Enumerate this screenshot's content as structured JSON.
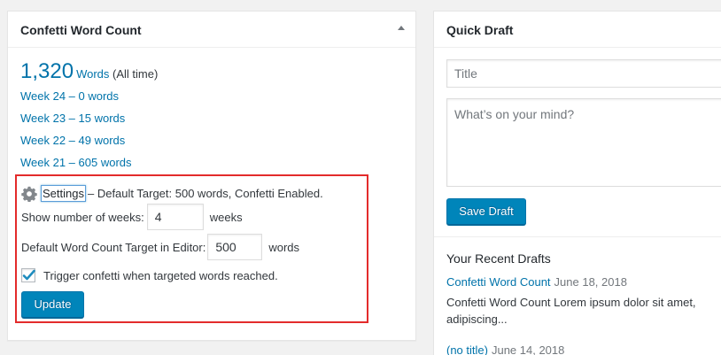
{
  "confetti_widget": {
    "title": "Confetti Word Count",
    "total_number": "1,320",
    "total_words_label": "Words",
    "total_suffix": "(All time)",
    "weeks": [
      "Week 24 – 0 words",
      "Week 23 – 15 words",
      "Week 22 – 49 words",
      "Week 21 – 605 words"
    ],
    "settings": {
      "link_label": "Settings",
      "summary": "– Default Target: 500 words, Confetti Enabled.",
      "weeks_label": "Show number of weeks:",
      "weeks_value": "4",
      "weeks_suffix": "weeks",
      "target_label": "Default Word Count Target in Editor:",
      "target_value": "500",
      "target_suffix": "words",
      "confetti_label": "Trigger confetti when targeted words reached.",
      "confetti_checked": true,
      "update_label": "Update"
    }
  },
  "quick_draft": {
    "title": "Quick Draft",
    "title_placeholder": "Title",
    "content_placeholder": "What’s on your mind?",
    "save_label": "Save Draft",
    "recent_title": "Your Recent Drafts",
    "drafts": [
      {
        "title": "Confetti Word Count",
        "date": "June 18, 2018",
        "excerpt": "Confetti Word Count Lorem ipsum dolor sit amet, adipiscing..."
      },
      {
        "title": "(no title)",
        "date": "June 14, 2018"
      }
    ]
  },
  "colors": {
    "link": "#0073aa",
    "primary_button": "#0085ba",
    "highlight_border": "#e32b2b"
  },
  "icons": [
    "gear-icon",
    "collapse-arrow-icon",
    "checkmark-icon"
  ]
}
